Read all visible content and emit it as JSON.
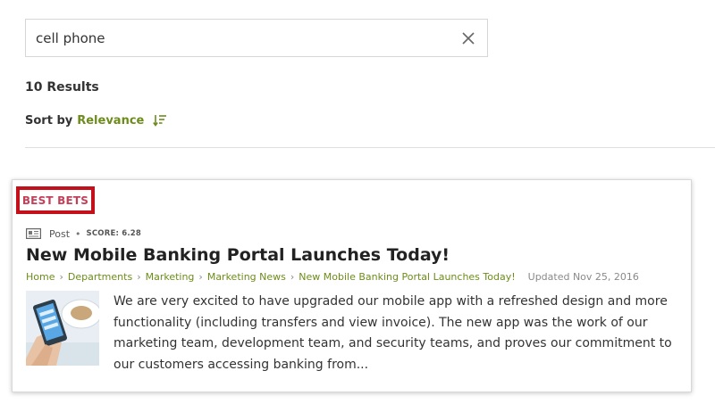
{
  "search": {
    "value": "cell phone",
    "clear_icon": "close-icon"
  },
  "results": {
    "count_label": "10 Results"
  },
  "sort": {
    "label": "Sort by",
    "value": "Relevance",
    "icon": "sort-descending-icon"
  },
  "colors": {
    "accent": "#6d8c1c",
    "best_bets_border": "#c4101a",
    "best_bets_text": "#c3405a"
  },
  "best_bets": {
    "label": "BEST BETS",
    "result": {
      "type_icon": "post-icon",
      "type": "Post",
      "separator": "•",
      "score": "SCORE: 6.28",
      "title": "New Mobile Banking Portal Launches Today!",
      "breadcrumb": [
        "Home",
        "Departments",
        "Marketing",
        "Marketing News",
        "New Mobile Banking Portal Launches Today!"
      ],
      "updated": "Updated Nov 25, 2016",
      "excerpt": "We are very excited to have upgraded our mobile app with a refreshed design and more functionality (including transfers and view invoice). The new app was the work of our marketing team, development team, and security teams, and proves our commitment to our customers accessing banking from..."
    }
  }
}
